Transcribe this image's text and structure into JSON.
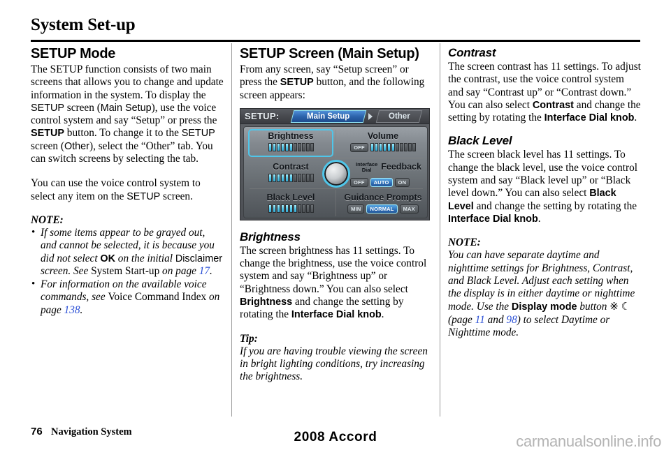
{
  "header": {
    "title": "System Set-up"
  },
  "col1": {
    "heading": "SETUP Mode",
    "para1_a": "The SETUP function consists of two main screens that allows you to change and update information in the system. To display the ",
    "para1_setup1": "SETUP",
    "para1_b": " screen (",
    "para1_mainsetup": "Main Setup",
    "para1_c": "), use the voice control system and say “Setup” or press the ",
    "para1_setupbold": "SETUP",
    "para1_d": " button. To change it to the ",
    "para1_setup2": "SETUP",
    "para1_e": " screen (",
    "para1_other": "Other",
    "para1_f": "), select the “Other” tab. You can switch screens by selecting the tab.",
    "para2_a": "You can use the voice control system to select any item on the ",
    "para2_setup": "SETUP",
    "para2_b": " screen.",
    "note_label": "NOTE:",
    "note1_a": "If some items appear to be grayed out, and cannot be selected, it is because you did not select ",
    "note1_ok": "OK",
    "note1_b": " on the initial ",
    "note1_disclaimer": "Disclaimer",
    "note1_c": " screen. See ",
    "note1_ref": "System Start-up",
    "note1_d": " on page ",
    "note1_page": "17",
    "note1_e": ".",
    "note2_a": "For information on the available voice commands, see ",
    "note2_ref": "Voice Command Index",
    "note2_b": " on page ",
    "note2_page": "138",
    "note2_c": "."
  },
  "col2": {
    "heading": "SETUP Screen (Main Setup)",
    "para1_a": "From any screen, say “Setup screen” or press the ",
    "para1_setup": "SETUP",
    "para1_b": " button, and the following screen appears:",
    "brightness_heading": "Brightness",
    "brightness_a": "The screen brightness has 11 settings. To change the brightness, use the voice control system and say “Brightness up” or “Brightness down.” You can also select ",
    "brightness_term": "Brightness",
    "brightness_b": " and change the setting by rotating the ",
    "brightness_dial": "Interface Dial knob",
    "brightness_c": ".",
    "tip_label": "Tip:",
    "tip_text": "If you are having trouble viewing the screen in bright lighting conditions, try increasing the brightness."
  },
  "navscreen": {
    "setup_label": "SETUP:",
    "tab_main": "Main Setup",
    "tab_other": "Other",
    "brightness_label": "Brightness",
    "brightness_segments_total": 11,
    "brightness_segments_on": 6,
    "volume_label": "Volume",
    "volume_off_button": "OFF",
    "volume_segments_total": 11,
    "volume_segments_on": 6,
    "contrast_label": "Contrast",
    "contrast_segments_total": 11,
    "contrast_segments_on": 6,
    "black_level_label": "Black Level",
    "black_level_segments_total": 11,
    "black_level_segments_on": 7,
    "interface_dial_label_line1": "Interface",
    "interface_dial_label_line2": "Dial",
    "feedback_label": "Feedback",
    "feedback_options": [
      "OFF",
      "AUTO",
      "ON"
    ],
    "feedback_selected": "AUTO",
    "guidance_label": "Guidance Prompts",
    "guidance_options": [
      "MIN",
      "NORMAL",
      "MAX"
    ],
    "guidance_selected": "NORMAL"
  },
  "col3": {
    "contrast_heading": "Contrast",
    "contrast_a": "The screen contrast has 11 settings. To adjust the contrast, use the voice control system and say “Contrast up” or “Contrast down.” You can also select ",
    "contrast_term": "Contrast",
    "contrast_b": " and change the setting by rotating the ",
    "contrast_dial": "Interface Dial knob",
    "contrast_c": ".",
    "black_heading": "Black Level",
    "black_a": "The screen black level has 11 settings. To change the black level, use the voice control system and say “Black level up” or “Black level down.” You can also select ",
    "black_term": "Black Level",
    "black_b": " and change the setting by rotating the ",
    "black_dial": "Interface Dial knob",
    "black_c": ".",
    "note_label": "NOTE:",
    "note_a": "You can have separate daytime and nighttime settings for Brightness, Contrast, and Black Level. Adjust each setting when the display is in either daytime or nighttime mode. Use the ",
    "note_displaymode": "Display mode",
    "note_b": " button ",
    "note_sun": "※",
    "note_moon": "☾",
    "note_c": " (page ",
    "note_page1": "11",
    "note_d": " and ",
    "note_page2": "98",
    "note_e": ") to select Daytime or Nighttime mode."
  },
  "footer": {
    "page_number": "76",
    "section": "Navigation System",
    "model": "2008  Accord",
    "watermark": "carmanualsonline.info"
  },
  "colors": {
    "link_blue": "#2a4fd6",
    "screen_accent_cyan": "#4fc6ea",
    "screen_tab_blue": "#2c63ab",
    "watermark_gray": "#b4b4b4"
  }
}
